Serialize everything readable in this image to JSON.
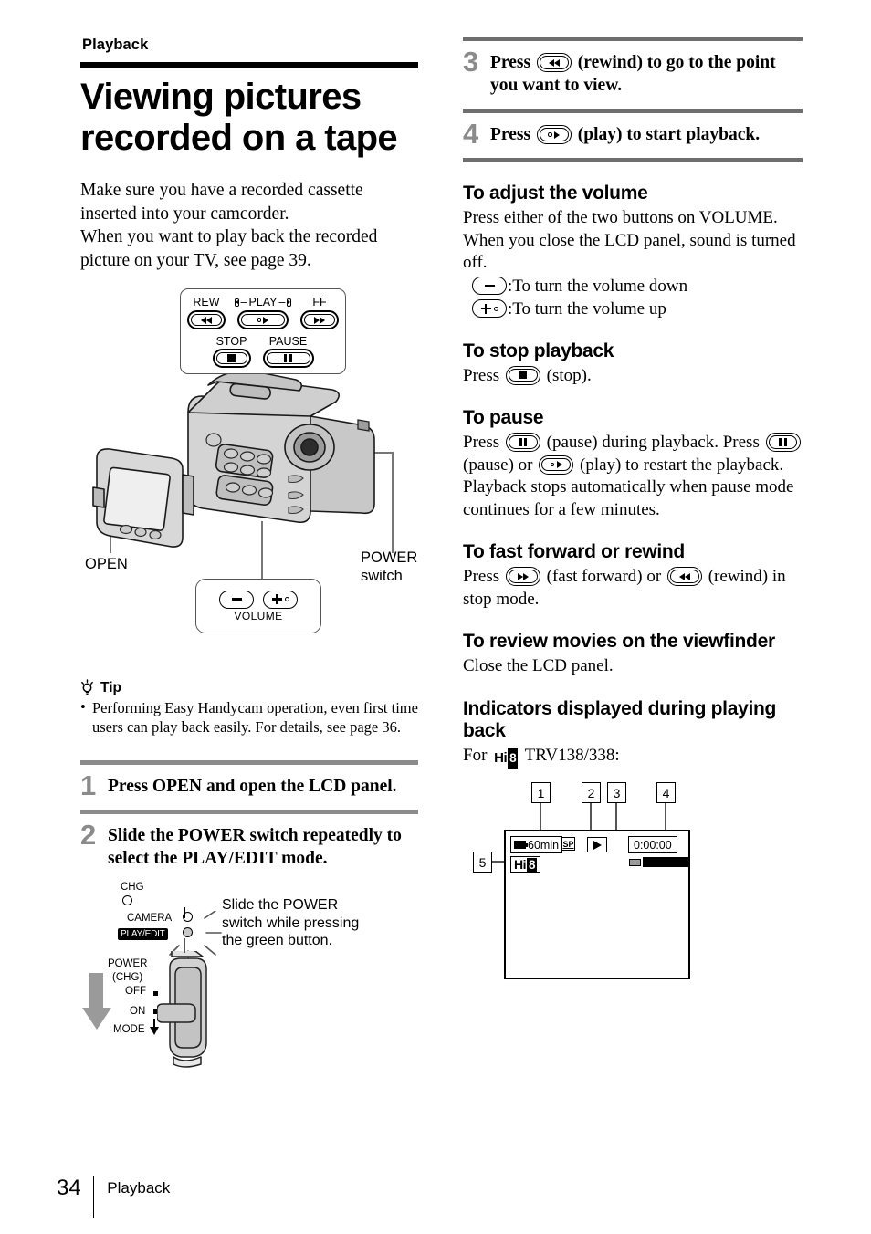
{
  "running_head": "Playback",
  "title": "Viewing pictures recorded on a tape",
  "intro": {
    "line1": "Make sure you have a recorded cassette",
    "line2": "inserted into your camcorder.",
    "line3": "When you want to play back the recorded",
    "line4": "picture on your TV, see page 39."
  },
  "transport_panel": {
    "rew_label": "REW",
    "play_label": "PLAY",
    "ff_label": "FF",
    "stop_label": "STOP",
    "pause_label": "PAUSE"
  },
  "callouts": {
    "open": "OPEN",
    "power_switch_line1": "POWER",
    "power_switch_line2": "switch",
    "volume": "VOLUME"
  },
  "tip": {
    "label": "Tip",
    "icon": "lightbulb-icon",
    "items": [
      "Performing Easy Handycam operation, even first time users can play back easily. For details, see page 36."
    ]
  },
  "steps": [
    {
      "num": "1",
      "text": "Press OPEN and open the LCD panel."
    },
    {
      "num": "2",
      "text": "Slide the POWER switch repeatedly to select the PLAY/EDIT mode."
    },
    {
      "num": "3",
      "text_before": "Press",
      "icon": "rewind-icon",
      "text_after": "(rewind) to go to the point you want to view."
    },
    {
      "num": "4",
      "text_before": "Press",
      "icon": "play-icon",
      "text_after": "(play) to start playback."
    }
  ],
  "power_switch_diagram": {
    "chg": "CHG",
    "camera": "CAMERA",
    "play_edit": "PLAY/EDIT",
    "power": "POWER",
    "chg2": "(CHG)",
    "off": "OFF",
    "on": "ON",
    "mode": "MODE",
    "note": "Slide the POWER switch while pressing the green button."
  },
  "sections": [
    {
      "heading": "To adjust the volume",
      "line1": "Press either of the two buttons on VOLUME.",
      "line2": "When you close the LCD panel, sound is turned",
      "line3": "off.",
      "vol_down": ":To turn the volume down",
      "vol_up": ":To turn the volume up"
    },
    {
      "heading": "To stop playback",
      "press": "Press",
      "icon": "stop-icon",
      "after": "(stop)."
    },
    {
      "heading": "To pause",
      "l1a": "Press",
      "l1_icon": "pause-icon",
      "l1b": "(pause) during playback. Press",
      "l2_icon1": "pause-icon",
      "l2a": "(pause) or",
      "l2_icon2": "play-icon",
      "l2b": "(play) to restart the",
      "l3": "playback.",
      "l4": "Playback stops automatically when pause mode",
      "l5": "continues for a few minutes."
    },
    {
      "heading": "To fast forward or rewind",
      "l1a": "Press",
      "icon1": "fast-forward-icon",
      "l1b": "(fast forward) or",
      "icon2": "rewind-icon",
      "l1c": "(rewind) in",
      "l2": "stop mode."
    },
    {
      "heading": "To review movies on the viewfinder",
      "body": "Close the LCD panel."
    },
    {
      "heading": "Indicators displayed during playing back",
      "for_prefix": "For",
      "logo": "Hi8",
      "models": "TRV138/338:"
    }
  ],
  "lcd_indicators": {
    "callout_numbers": [
      "1",
      "2",
      "3",
      "4",
      "5"
    ],
    "battery_time": "60min",
    "rec_mode": "SP",
    "play_symbol": "play-triangle",
    "timecode": "0:00:00",
    "format_logo": "Hi8"
  },
  "footer": {
    "page_number": "34",
    "section": "Playback"
  }
}
